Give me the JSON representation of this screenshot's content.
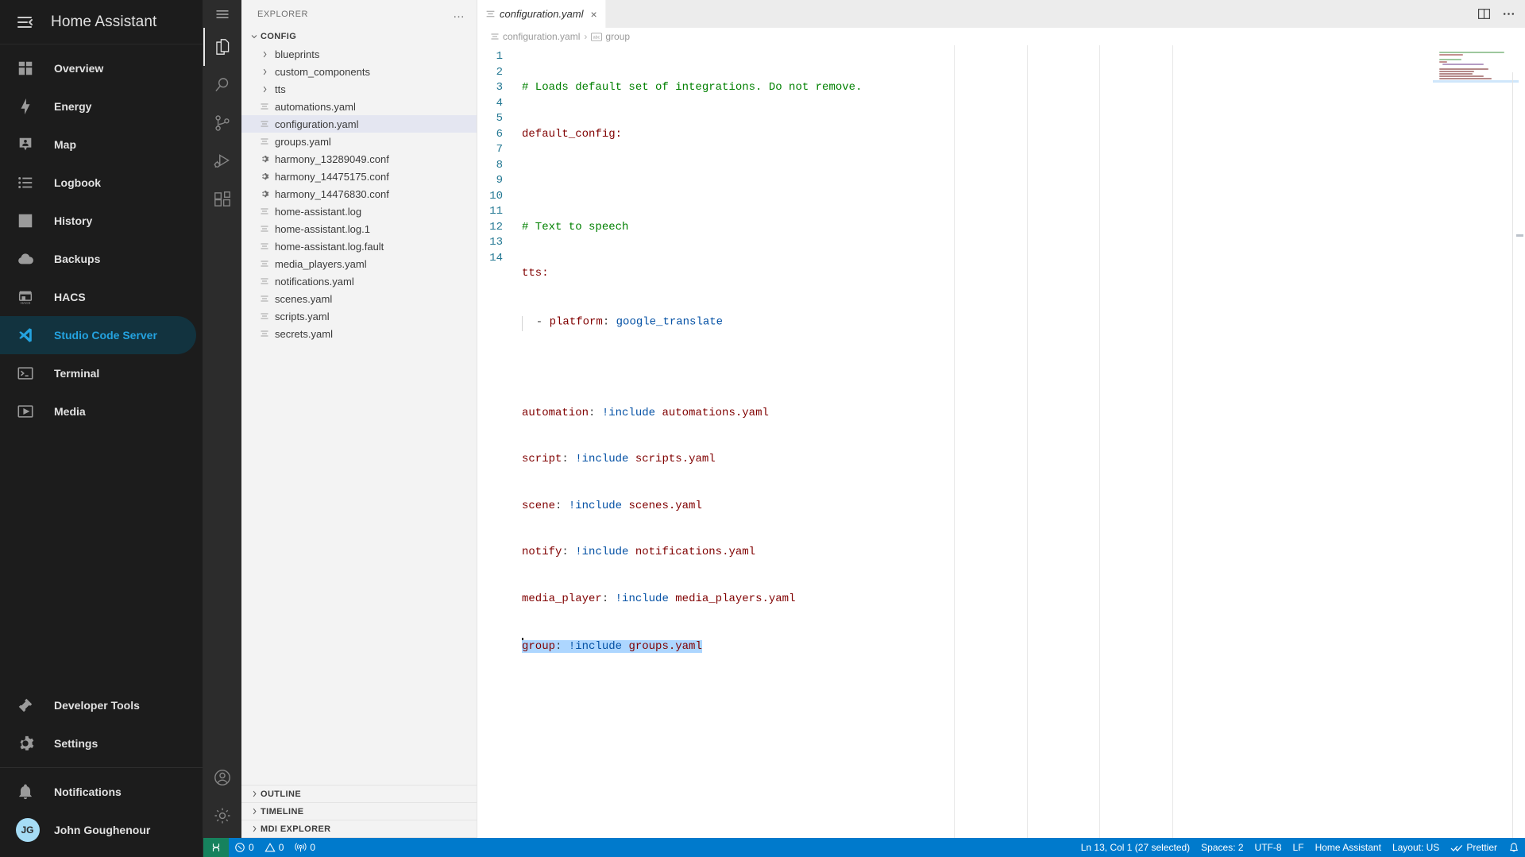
{
  "home_assistant": {
    "title": "Home Assistant",
    "menu_icon": "menu-collapse-icon",
    "items": [
      {
        "label": "Overview",
        "icon": "view-dashboard-icon",
        "active": false
      },
      {
        "label": "Energy",
        "icon": "lightning-bolt-icon",
        "active": false
      },
      {
        "label": "Map",
        "icon": "map-marker-account-icon",
        "active": false
      },
      {
        "label": "Logbook",
        "icon": "format-list-bulleted-icon",
        "active": false
      },
      {
        "label": "History",
        "icon": "chart-box-icon",
        "active": false
      },
      {
        "label": "Backups",
        "icon": "cloud-icon",
        "active": false
      },
      {
        "label": "HACS",
        "icon": "hacs-storefront-icon",
        "active": false
      },
      {
        "label": "Studio Code Server",
        "icon": "vscode-icon",
        "active": true
      },
      {
        "label": "Terminal",
        "icon": "console-icon",
        "active": false
      },
      {
        "label": "Media",
        "icon": "play-box-icon",
        "active": false
      }
    ],
    "bottom_items": [
      {
        "label": "Developer Tools",
        "icon": "hammer-icon"
      },
      {
        "label": "Settings",
        "icon": "cog-icon"
      }
    ],
    "user_items": [
      {
        "label": "Notifications",
        "icon": "bell-icon"
      }
    ],
    "user": {
      "name": "John Goughenour",
      "initials": "JG"
    },
    "accent_color": "#24a3e0",
    "background_color": "#1c1c1c"
  },
  "vscode": {
    "activitybar": {
      "hamburger": "menu-icon",
      "items": [
        {
          "name": "explorer",
          "icon": "files-icon",
          "active": true
        },
        {
          "name": "search",
          "icon": "search-icon",
          "active": false
        },
        {
          "name": "source-control",
          "icon": "source-control-icon",
          "active": false
        },
        {
          "name": "run-and-debug",
          "icon": "run-debug-icon",
          "active": false
        },
        {
          "name": "extensions",
          "icon": "extensions-icon",
          "active": false
        }
      ],
      "bottom": [
        {
          "name": "accounts",
          "icon": "account-icon"
        },
        {
          "name": "manage",
          "icon": "gear-icon"
        }
      ]
    },
    "explorer": {
      "title": "EXPLORER",
      "more_actions": "…",
      "root_folder": "CONFIG",
      "files": [
        {
          "name": "blueprints",
          "type": "folder",
          "expanded": false,
          "selected": false
        },
        {
          "name": "custom_components",
          "type": "folder",
          "expanded": false,
          "selected": false
        },
        {
          "name": "tts",
          "type": "folder",
          "expanded": false,
          "selected": false
        },
        {
          "name": "automations.yaml",
          "type": "yaml",
          "selected": false
        },
        {
          "name": "configuration.yaml",
          "type": "yaml",
          "selected": true
        },
        {
          "name": "groups.yaml",
          "type": "yaml",
          "selected": false
        },
        {
          "name": "harmony_13289049.conf",
          "type": "conf",
          "selected": false
        },
        {
          "name": "harmony_14475175.conf",
          "type": "conf",
          "selected": false
        },
        {
          "name": "harmony_14476830.conf",
          "type": "conf",
          "selected": false
        },
        {
          "name": "home-assistant.log",
          "type": "log",
          "selected": false
        },
        {
          "name": "home-assistant.log.1",
          "type": "log",
          "selected": false
        },
        {
          "name": "home-assistant.log.fault",
          "type": "log",
          "selected": false
        },
        {
          "name": "media_players.yaml",
          "type": "yaml",
          "selected": false
        },
        {
          "name": "notifications.yaml",
          "type": "yaml",
          "selected": false
        },
        {
          "name": "scenes.yaml",
          "type": "yaml",
          "selected": false
        },
        {
          "name": "scripts.yaml",
          "type": "yaml",
          "selected": false
        },
        {
          "name": "secrets.yaml",
          "type": "yaml",
          "selected": false
        }
      ],
      "panels": [
        {
          "label": "OUTLINE"
        },
        {
          "label": "TIMELINE"
        },
        {
          "label": "MDI EXPLORER"
        }
      ]
    },
    "editor": {
      "tabs": [
        {
          "label": "configuration.yaml",
          "active": true,
          "italic": true,
          "close": "×"
        }
      ],
      "actions": [
        {
          "name": "split-editor-right",
          "icon": "split-editor-icon"
        },
        {
          "name": "more-actions",
          "icon": "ellipsis-icon"
        }
      ],
      "breadcrumbs": [
        {
          "label": "configuration.yaml",
          "icon": "yaml-file-icon"
        },
        {
          "label": "group",
          "icon": "abc-symbol-icon"
        }
      ],
      "line_numbers": [
        "1",
        "2",
        "3",
        "4",
        "5",
        "6",
        "7",
        "8",
        "9",
        "10",
        "11",
        "12",
        "13",
        "14"
      ],
      "lines": [
        {
          "n": 1,
          "text": "# Loads default set of integrations. Do not remove."
        },
        {
          "n": 2,
          "text": "default_config:"
        },
        {
          "n": 3,
          "text": ""
        },
        {
          "n": 4,
          "text": "# Text to speech"
        },
        {
          "n": 5,
          "text": "tts:"
        },
        {
          "n": 6,
          "text": "  - platform: google_translate"
        },
        {
          "n": 7,
          "text": ""
        },
        {
          "n": 8,
          "text": "automation: !include automations.yaml"
        },
        {
          "n": 9,
          "text": "script: !include scripts.yaml"
        },
        {
          "n": 10,
          "text": "scene: !include scenes.yaml"
        },
        {
          "n": 11,
          "text": "notify: !include notifications.yaml"
        },
        {
          "n": 12,
          "text": "media_player: !include media_players.yaml"
        },
        {
          "n": 13,
          "text": "group: !include groups.yaml"
        },
        {
          "n": 14,
          "text": ""
        }
      ],
      "selected_line": 13,
      "colors": {
        "comment": "#008000",
        "key": "#800000",
        "value": "#0451a5",
        "plain": "#3b3b3b",
        "selection": "#add6ff",
        "line_number": "#237893"
      }
    },
    "statusbar": {
      "remote_icon": "remote-window-icon",
      "problems": [
        {
          "icon": "error-icon",
          "count": "0"
        },
        {
          "icon": "warning-icon",
          "count": "0"
        }
      ],
      "ports": {
        "icon": "ports-icon",
        "count": "0"
      },
      "right": [
        {
          "name": "cursor-position",
          "label": "Ln 13, Col 1 (27 selected)"
        },
        {
          "name": "indentation",
          "label": "Spaces: 2"
        },
        {
          "name": "encoding",
          "label": "UTF-8"
        },
        {
          "name": "eol",
          "label": "LF"
        },
        {
          "name": "language-mode",
          "label": "Home Assistant"
        },
        {
          "name": "keyboard-layout",
          "label": "Layout: US"
        },
        {
          "name": "prettier",
          "label": "Prettier",
          "icon": "check-check-icon"
        }
      ],
      "bell": "bell-icon",
      "background": "#007acc"
    }
  }
}
